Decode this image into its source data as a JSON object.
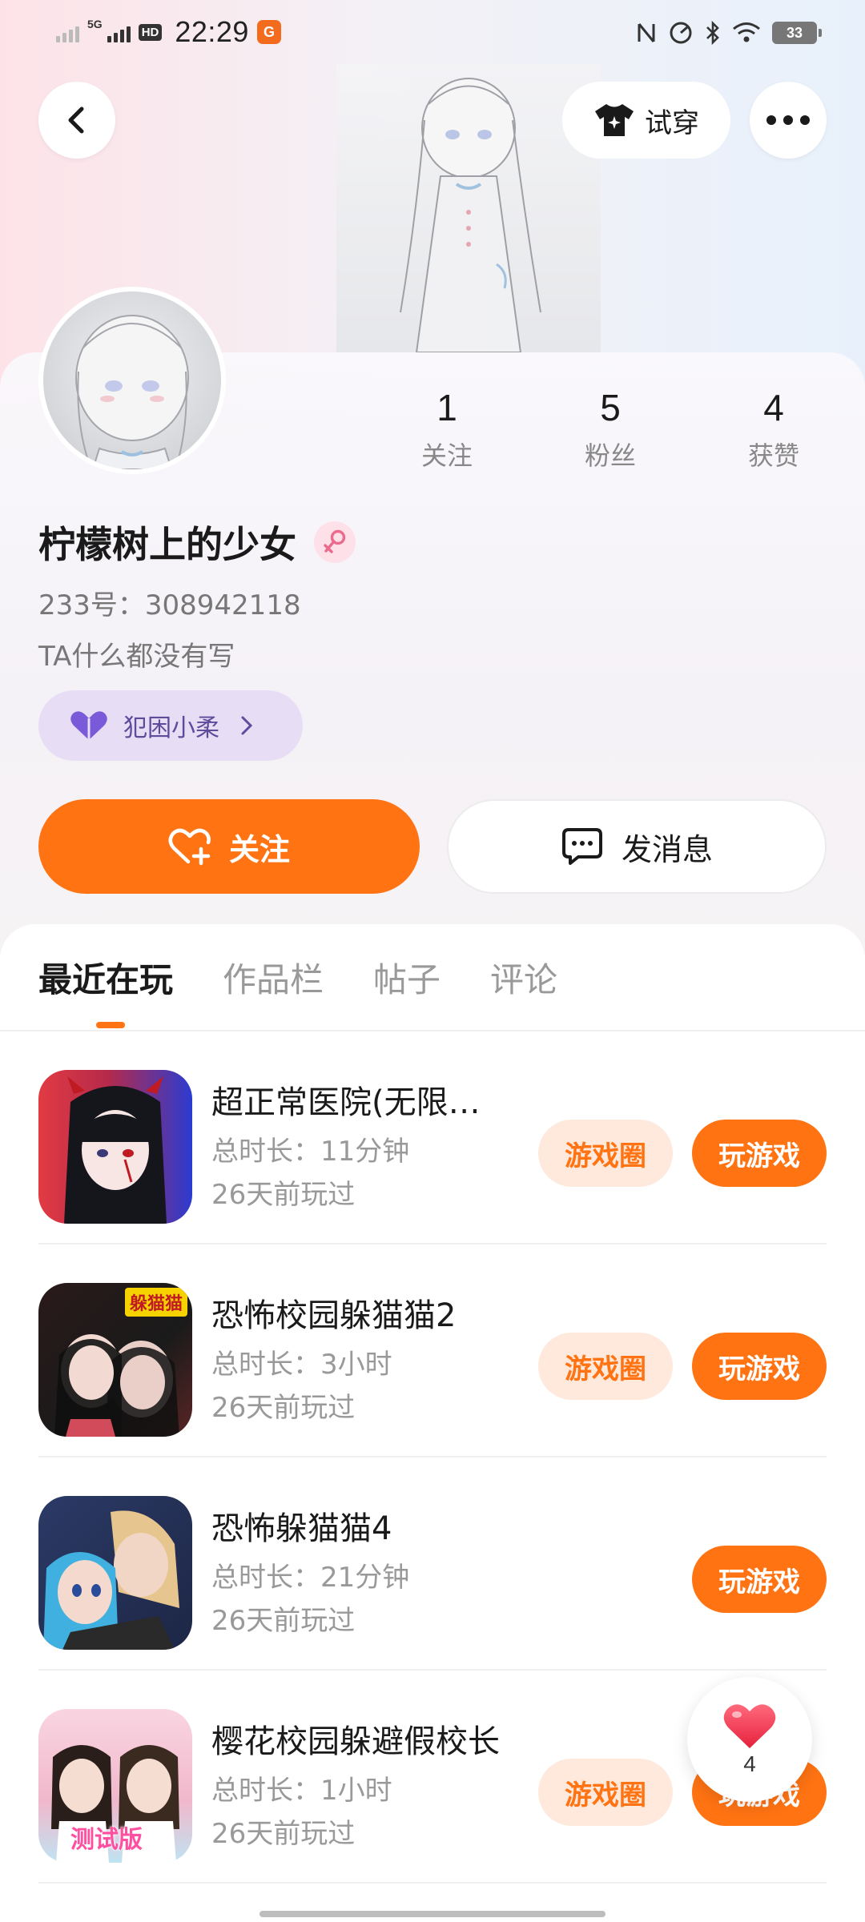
{
  "status_bar": {
    "time": "22:29",
    "network": "5G",
    "hd": "HD",
    "app_badge": "G",
    "battery": "33"
  },
  "header": {
    "tryon_label": "试穿"
  },
  "profile": {
    "stats": [
      {
        "value": "1",
        "label": "关注"
      },
      {
        "value": "5",
        "label": "粉丝"
      },
      {
        "value": "4",
        "label": "获赞"
      }
    ],
    "name": "柠檬树上的少女",
    "uid": "233号：308942118",
    "bio": "TA什么都没有写",
    "tag": "犯困小柔"
  },
  "actions": {
    "follow": "关注",
    "message": "发消息"
  },
  "tabs": [
    "最近在玩",
    "作品栏",
    "帖子",
    "评论"
  ],
  "games": [
    {
      "title": "超正常医院(无限…",
      "duration": "总时长：11分钟",
      "last_played": "26天前玩过",
      "circle_label": "游戏圈",
      "play_label": "玩游戏",
      "icon_colors": [
        "#e8373f",
        "#2b3bd1"
      ]
    },
    {
      "title": "恐怖校园躲猫猫2",
      "duration": "总时长：3小时",
      "last_played": "26天前玩过",
      "circle_label": "游戏圈",
      "play_label": "玩游戏",
      "icon_colors": [
        "#1a1a1a",
        "#8a2b2b"
      ]
    },
    {
      "title": "恐怖躲猫猫4",
      "duration": "总时长：21分钟",
      "last_played": "26天前玩过",
      "circle_label": "",
      "play_label": "玩游戏",
      "icon_colors": [
        "#2a3c6b",
        "#4fa9d6"
      ]
    },
    {
      "title": "樱花校园躲避假校长",
      "duration": "总时长：1小时",
      "last_played": "26天前玩过",
      "circle_label": "游戏圈",
      "play_label": "玩游戏",
      "icon_colors": [
        "#f6c7d6",
        "#9dd0e8"
      ]
    }
  ],
  "icon_badges": {
    "game_2": "躲猫猫",
    "game_4": "测试版"
  },
  "like_float": {
    "count": "4"
  },
  "colors": {
    "accent": "#ff7313",
    "accent_light": "#ffe9dc",
    "tag_bg": "#e7def6",
    "tag_text": "#5d4b9c"
  }
}
